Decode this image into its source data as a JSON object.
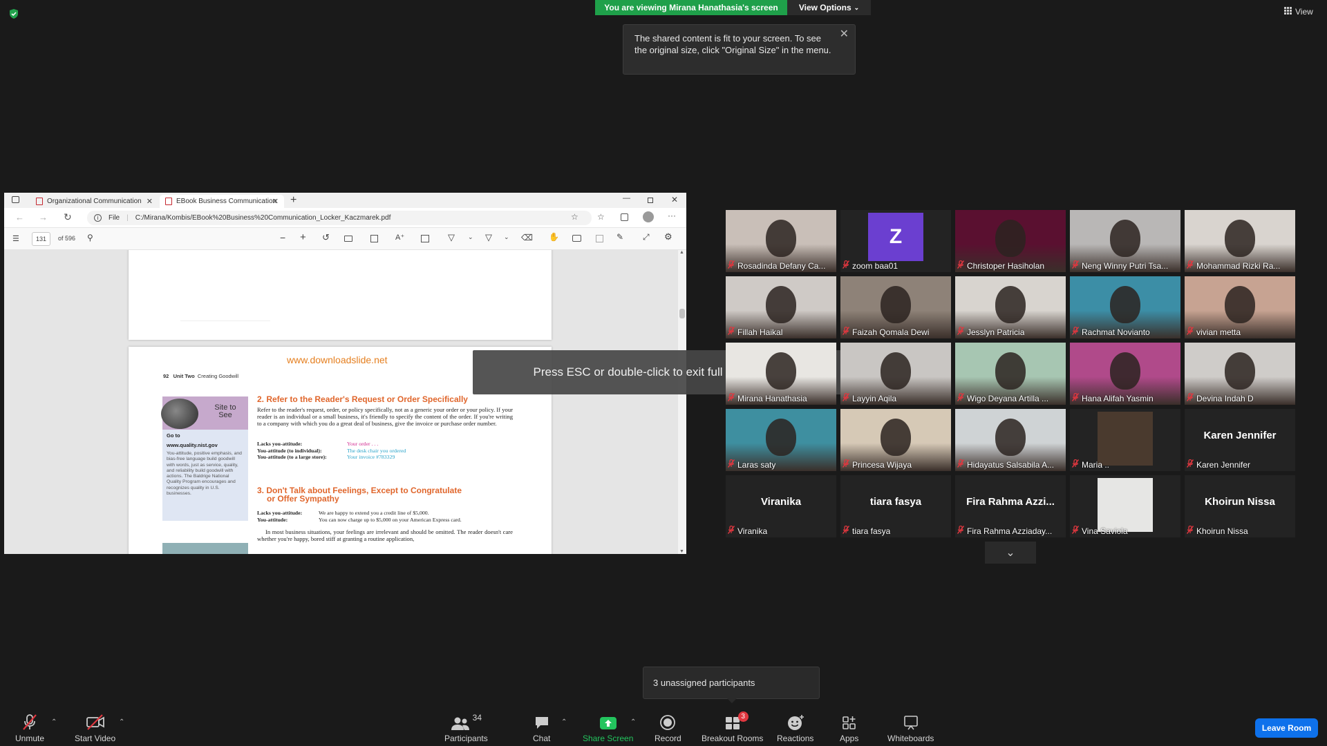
{
  "top": {
    "viewing_banner": "You are viewing Mirana Hanathasia's screen",
    "view_options": "View Options",
    "view_label": "View",
    "tooltip": "The shared content is fit to your screen. To see the original size, click \"Original Size\" in the menu."
  },
  "browser": {
    "tabs": [
      {
        "label": "Organizational Communication"
      },
      {
        "label": "EBook Business Communication"
      }
    ],
    "file_label": "File",
    "url": "C:/Mirana/Kombis/EBook%20Business%20Communication_Locker_Kaczmarek.pdf",
    "page_number": "131",
    "page_total": "of 596"
  },
  "doc": {
    "site": "www.downloadslide.net",
    "page_num": "92",
    "unit": "Unit Two",
    "unit_sub": "Creating Goodwill",
    "sidebar_title": "Site to See",
    "sidebar_goto": "Go to",
    "sidebar_url": "www.quality.nist.gov",
    "sidebar_body": "You-attitude, positive emphasis, and bias-free language build goodwill with words, just as service, quality, and reliability build goodwill with actions. The Baldrige National Quality Program encourages and recognizes quality in U.S. businesses.",
    "h2": "2. Refer to the Reader's Request or Order Specifically",
    "p2": "Refer to the reader's request, order, or policy specifically, not as a generic your order or your policy. If your reader is an individual or a small business, it's friendly to specify the content of the order. If you're writing to a company with which you do a great deal of business, give the invoice or purchase order number.",
    "ex2": [
      {
        "label": "Lacks you-attitude:",
        "text": "Your order . . ."
      },
      {
        "label": "You-attitude (to individual):",
        "text": "The desk chair you ordered"
      },
      {
        "label": "You-attitude (to a large store):",
        "text": "Your invoice #783329"
      }
    ],
    "h3a": "3. Don't Talk about Feelings, Except to Congratulate",
    "h3b": "or Offer Sympathy",
    "ex3": [
      {
        "label": "Lacks you-attitude:",
        "text": "We are happy to extend you a credit line of $5,000."
      },
      {
        "label": "You-attitude:",
        "text": "You can now charge up to $5,000 on your American Express card."
      }
    ],
    "p3": "In most business situations, your feelings are irrelevant and should be omitted. The reader doesn't care whether you're happy, bored stiff at granting a routine application,"
  },
  "esc_message": "Press ESC or double-click to exit full screen mode",
  "participants": [
    {
      "name": "Rosadinda Defany Ca...",
      "kind": "video",
      "color": "#c9bfb8"
    },
    {
      "name": "zoom baa01",
      "kind": "avatar",
      "initial": "Z",
      "color": "#6b3fd0"
    },
    {
      "name": "Christoper Hasiholan",
      "kind": "video",
      "color": "#5a1030"
    },
    {
      "name": "Neng Winny Putri Tsa...",
      "kind": "video",
      "color": "#b9b7b6"
    },
    {
      "name": "Mohammad Rizki Ra...",
      "kind": "video",
      "color": "#d9d4cf"
    },
    {
      "name": "Fillah Haikal",
      "kind": "video",
      "color": "#cfcac6"
    },
    {
      "name": "Faizah Qomala Dewi",
      "kind": "video",
      "color": "#8e8278"
    },
    {
      "name": "Jesslyn Patricia",
      "kind": "video",
      "color": "#d8d4cf"
    },
    {
      "name": "Rachmat Novianto",
      "kind": "video",
      "color": "#3c8ea6"
    },
    {
      "name": "vivian metta",
      "kind": "video",
      "color": "#c7a392"
    },
    {
      "name": "Mirana Hanathasia",
      "kind": "video",
      "color": "#e8e6e2",
      "active": true
    },
    {
      "name": "Layyin Aqila",
      "kind": "video",
      "color": "#c9c6c3"
    },
    {
      "name": "Wigo Deyana Artilla ...",
      "kind": "video",
      "color": "#a7c6b2"
    },
    {
      "name": "Hana Alifah Yasmin",
      "kind": "video",
      "color": "#b04a8a"
    },
    {
      "name": "Devina Indah D",
      "kind": "video",
      "color": "#cfccc9"
    },
    {
      "name": "Laras saty",
      "kind": "video",
      "color": "#3e8fa0"
    },
    {
      "name": "Princesa Wijaya",
      "kind": "video",
      "color": "#d6c9b6"
    },
    {
      "name": "Hidayatus Salsabila A...",
      "kind": "video",
      "color": "#cfd3d5"
    },
    {
      "name": "Maria ..",
      "kind": "small",
      "color": "#4a3a2e"
    },
    {
      "name": "Karen Jennifer",
      "kind": "name",
      "display": "Karen Jennifer"
    },
    {
      "name": "Viranika",
      "kind": "name",
      "display": "Viranika"
    },
    {
      "name": "tiara fasya",
      "kind": "name",
      "display": "tiara fasya"
    },
    {
      "name": "Fira Rahma Azziaday...",
      "kind": "name",
      "display": "Fira Rahma Azzi..."
    },
    {
      "name": "Vina Saviola",
      "kind": "small",
      "color": "#e6e6e4"
    },
    {
      "name": "Khoirun Nissa",
      "kind": "name",
      "display": "Khoirun Nissa"
    }
  ],
  "unassigned": "3 unassigned participants",
  "toolbar": {
    "unmute": "Unmute",
    "start_video": "Start Video",
    "participants": "Participants",
    "participants_count": "34",
    "chat": "Chat",
    "share_screen": "Share Screen",
    "record": "Record",
    "breakout_rooms": "Breakout Rooms",
    "breakout_badge": "3",
    "reactions": "Reactions",
    "apps": "Apps",
    "whiteboards": "Whiteboards",
    "leave_room": "Leave Room"
  },
  "colors": {
    "banner_green": "#1fa04a",
    "leave_blue": "#0e71eb",
    "active_speaker": "#f7e45b",
    "mute_red": "#e0373f",
    "heading_orange": "#e0662c"
  }
}
